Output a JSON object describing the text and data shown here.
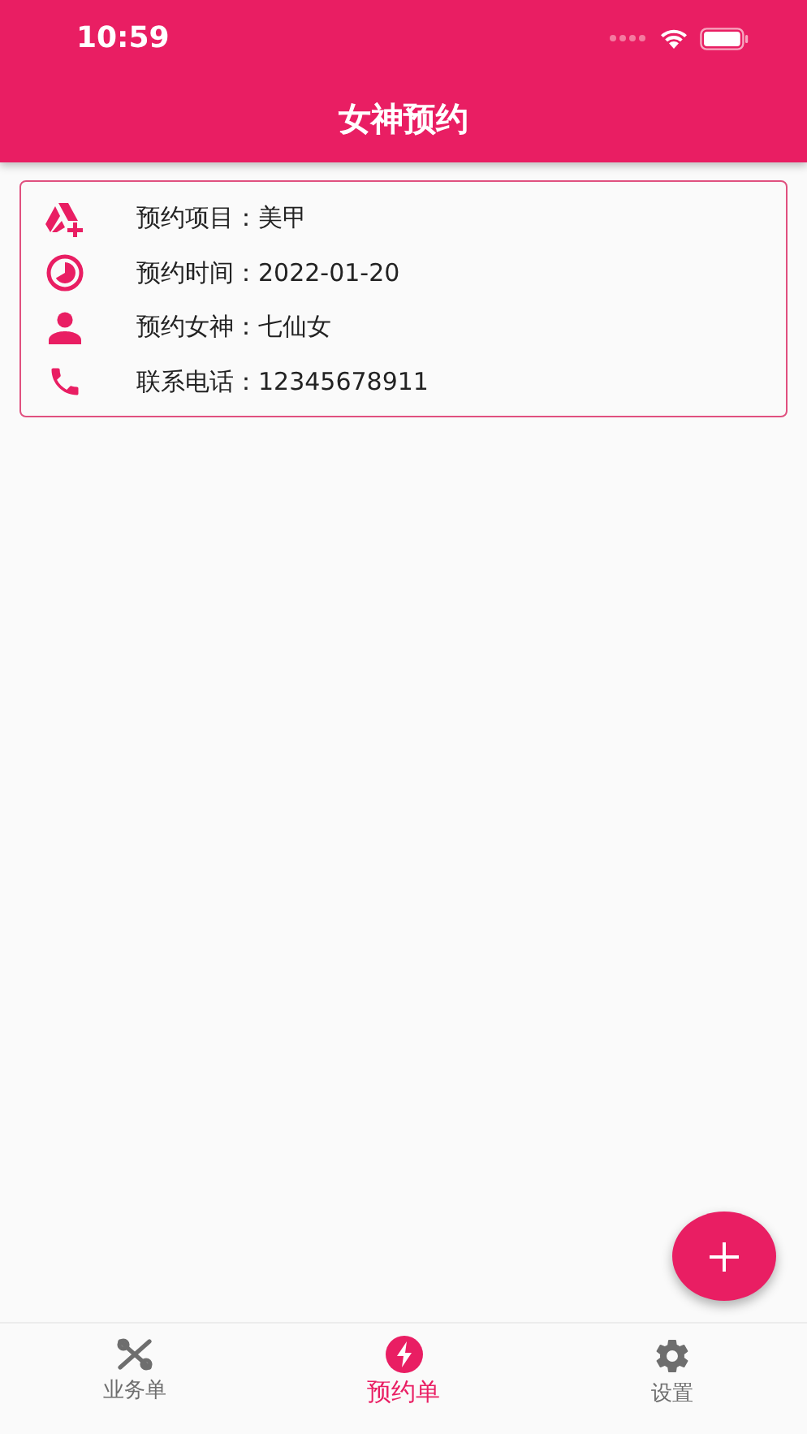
{
  "status_bar": {
    "time": "10:59"
  },
  "header": {
    "title": "女神预约"
  },
  "card": {
    "rows": [
      {
        "kind": "service",
        "text": "预约项目：美甲"
      },
      {
        "kind": "time",
        "text": "预约时间：2022-01-20"
      },
      {
        "kind": "person",
        "text": "预约女神：七仙女"
      },
      {
        "kind": "phone",
        "text": "联系电话：12345678911"
      }
    ]
  },
  "tabs": [
    {
      "kind": "orders",
      "label": "业务单",
      "selected": false
    },
    {
      "kind": "booking",
      "label": "预约单",
      "selected": true
    },
    {
      "kind": "settings",
      "label": "设置",
      "selected": false
    }
  ]
}
